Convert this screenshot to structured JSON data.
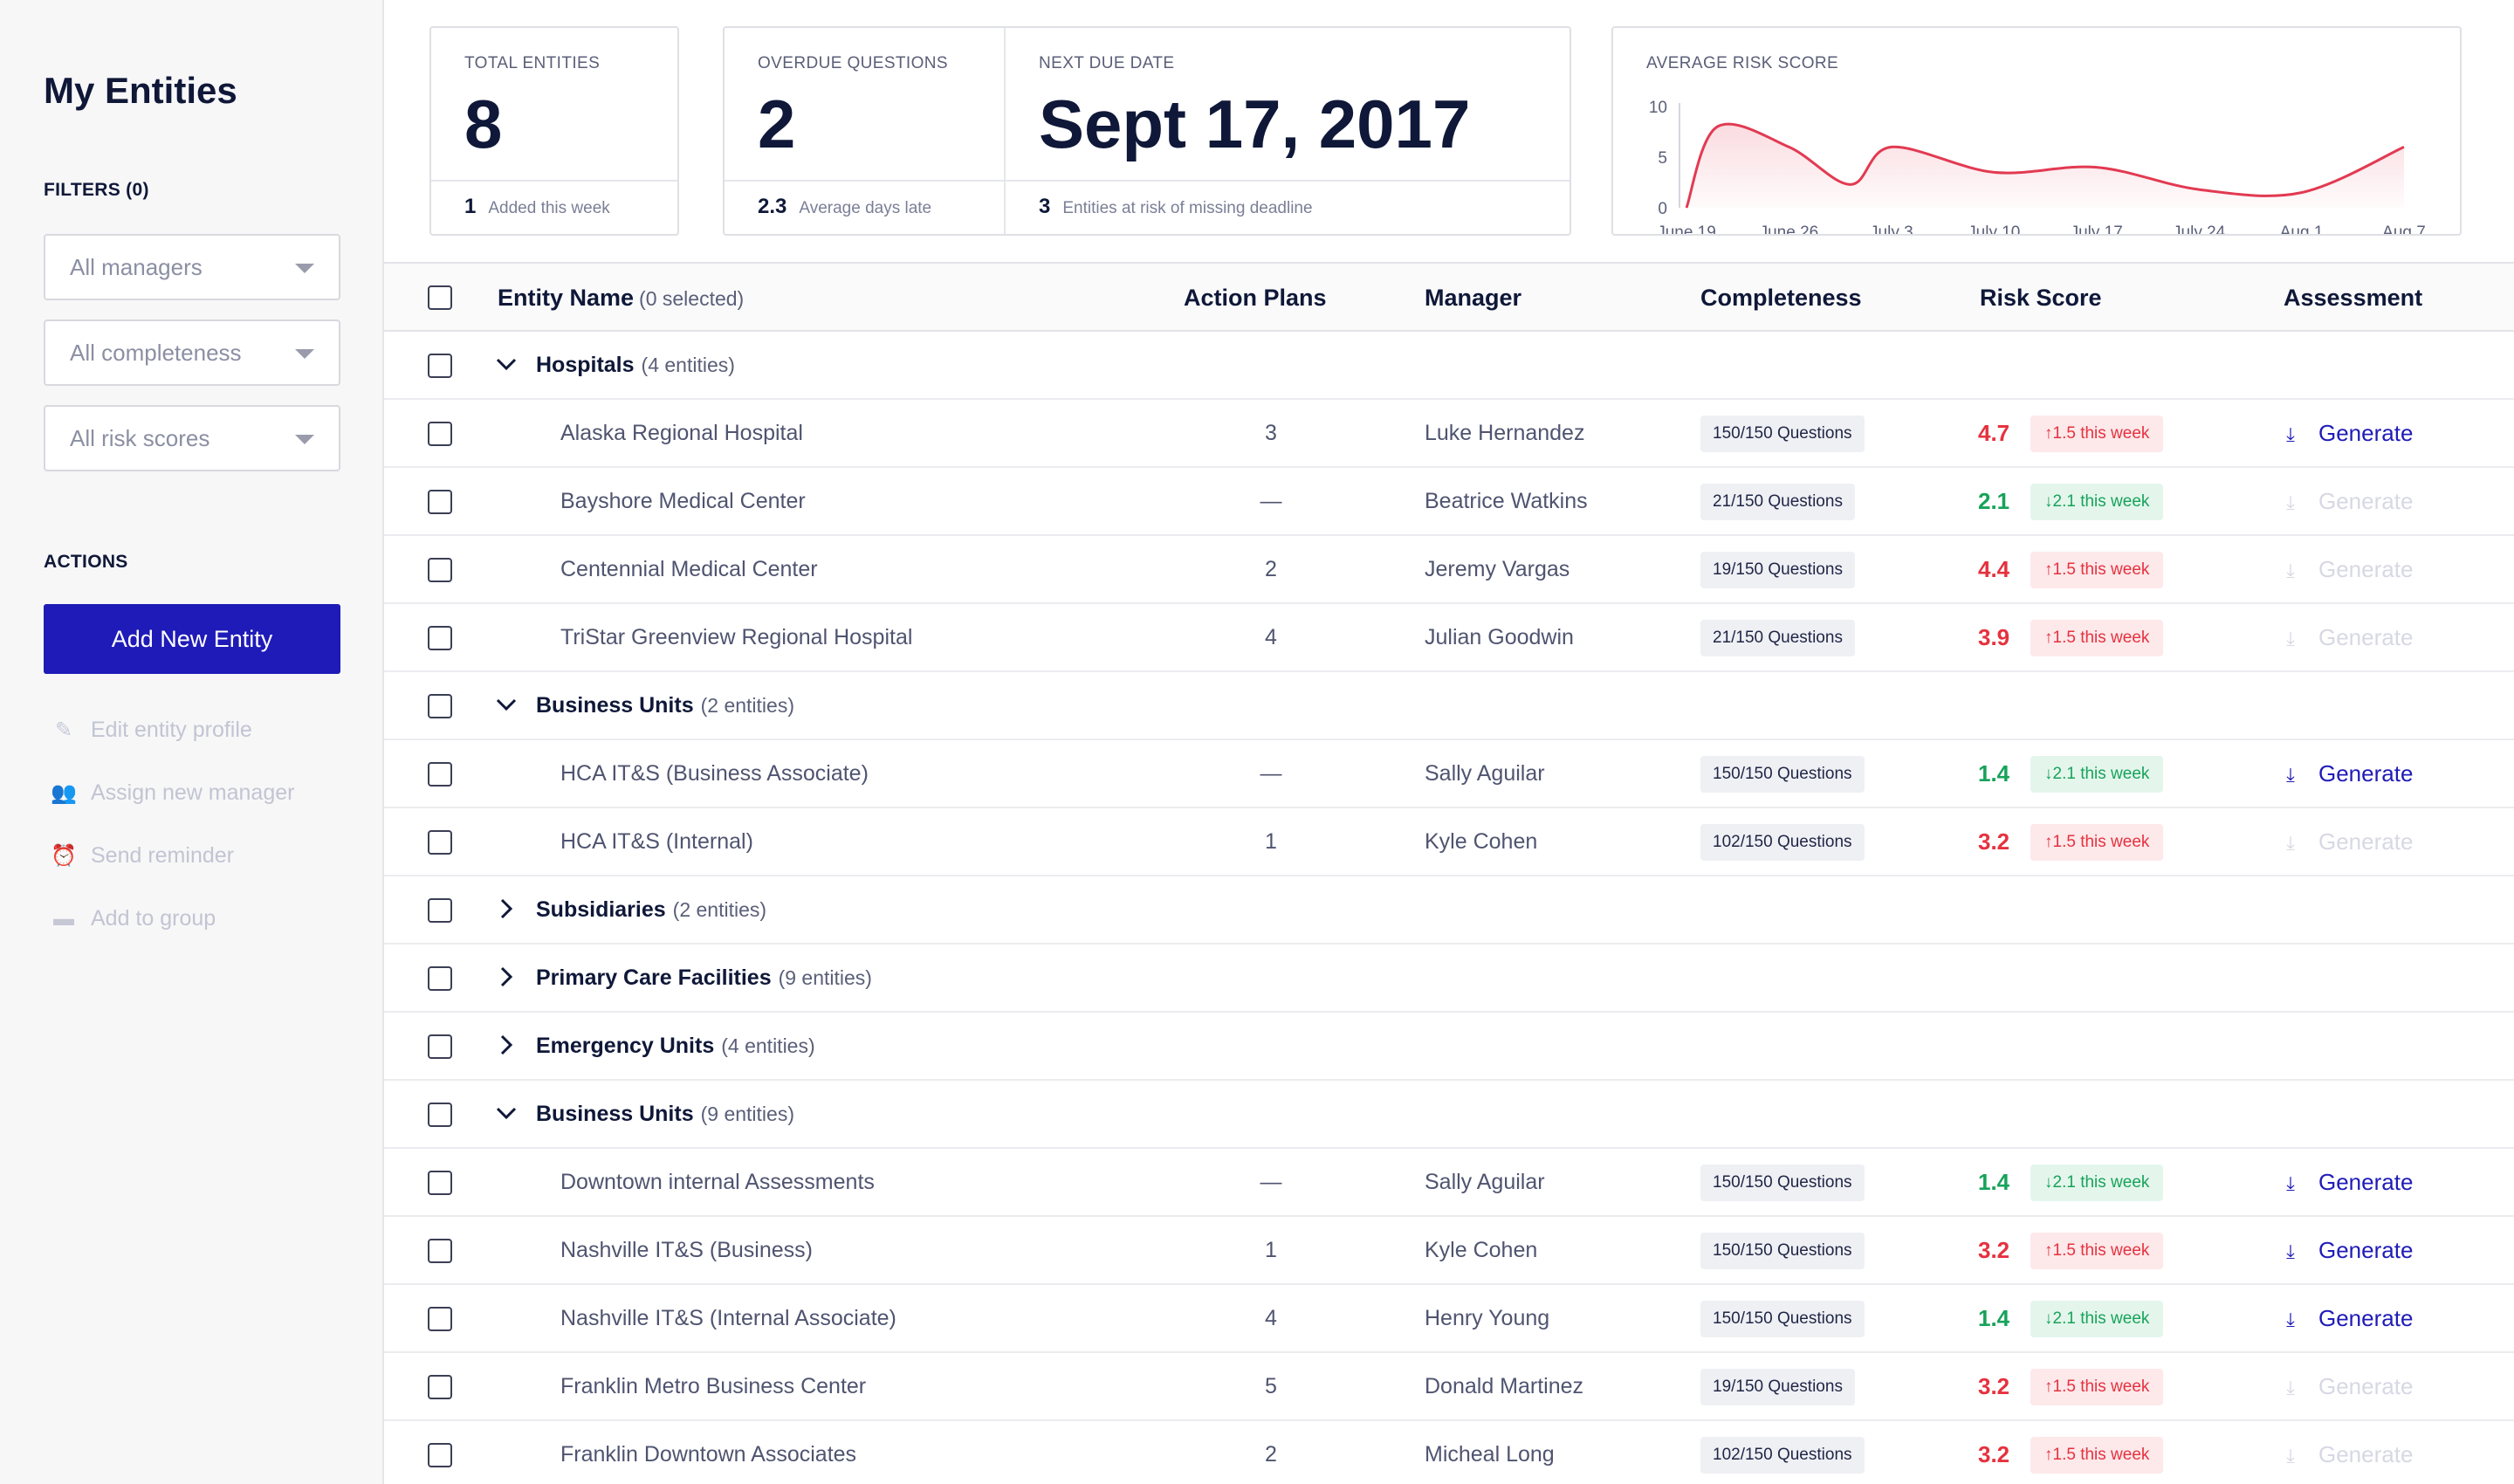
{
  "sidebar": {
    "title": "My Entities",
    "filters_label": "FILTERS (0)",
    "filters": [
      "All managers",
      "All completeness",
      "All risk scores"
    ],
    "actions_label": "ACTIONS",
    "add_button": "Add New Entity",
    "actions": [
      {
        "label": "Edit entity profile",
        "icon": "pencil-icon"
      },
      {
        "label": "Assign new manager",
        "icon": "user-add-icon"
      },
      {
        "label": "Send reminder",
        "icon": "alarm-icon"
      },
      {
        "label": "Add to group",
        "icon": "folder-icon"
      }
    ]
  },
  "kpis": {
    "total": {
      "label": "TOTAL ENTITIES",
      "value": "8",
      "foot_value": "1",
      "foot_label": "Added this week"
    },
    "overdue": {
      "label": "OVERDUE QUESTIONS",
      "value": "2",
      "foot_value": "2.3",
      "foot_label": "Average days late"
    },
    "due": {
      "label": "NEXT DUE DATE",
      "value": "Sept 17, 2017",
      "foot_value": "3",
      "foot_label": "Entities at risk of missing deadline"
    }
  },
  "risk_chart": {
    "label": "AVERAGE RISK SCORE",
    "color": "#e23a52"
  },
  "chart_data": {
    "type": "area",
    "title": "AVERAGE RISK SCORE",
    "categories": [
      "June 19",
      "June 26",
      "July 3",
      "July 10",
      "July 17",
      "July 24",
      "Aug 1",
      "Aug 7"
    ],
    "x": [
      0,
      0.3,
      1,
      1.6,
      2,
      3,
      4,
      5,
      6,
      7
    ],
    "y": [
      0,
      8,
      6,
      2.3,
      6,
      3.5,
      4,
      1.8,
      1.5,
      6
    ],
    "yticks": [
      0,
      5,
      10
    ],
    "ylim": [
      0,
      10
    ],
    "grid": false,
    "color": "#e23a52"
  },
  "table": {
    "headers": {
      "name": "Entity Name",
      "selected": "(0 selected)",
      "plans": "Action Plans",
      "manager": "Manager",
      "completeness": "Completeness",
      "risk": "Risk Score",
      "assessment": "Assessment"
    },
    "generate_label": "Generate",
    "rows": [
      {
        "type": "group",
        "name": "Hospitals",
        "count": "(4 entities)",
        "expanded": true
      },
      {
        "type": "entity",
        "name": "Alaska Regional Hospital",
        "plans": "3",
        "manager": "Luke Hernandez",
        "completeness": "150/150 Questions",
        "risk": "4.7",
        "trend": "up",
        "delta": "1.5 this week",
        "generate_enabled": true
      },
      {
        "type": "entity",
        "name": "Bayshore Medical Center",
        "plans": "—",
        "manager": "Beatrice Watkins",
        "completeness": "21/150 Questions",
        "risk": "2.1",
        "trend": "down",
        "delta": "2.1 this week",
        "generate_enabled": false
      },
      {
        "type": "entity",
        "name": "Centennial Medical Center",
        "plans": "2",
        "manager": "Jeremy Vargas",
        "completeness": "19/150 Questions",
        "risk": "4.4",
        "trend": "up",
        "delta": "1.5 this week",
        "generate_enabled": false
      },
      {
        "type": "entity",
        "name": "TriStar Greenview Regional Hospital",
        "plans": "4",
        "manager": "Julian Goodwin",
        "completeness": "21/150 Questions",
        "risk": "3.9",
        "trend": "up",
        "delta": "1.5 this week",
        "generate_enabled": false
      },
      {
        "type": "group",
        "name": "Business Units",
        "count": "(2 entities)",
        "expanded": true
      },
      {
        "type": "entity",
        "name": "HCA IT&S (Business Associate)",
        "plans": "—",
        "manager": "Sally Aguilar",
        "completeness": "150/150 Questions",
        "risk": "1.4",
        "trend": "down",
        "delta": "2.1 this week",
        "generate_enabled": true
      },
      {
        "type": "entity",
        "name": "HCA IT&S (Internal)",
        "plans": "1",
        "manager": "Kyle Cohen",
        "completeness": "102/150 Questions",
        "risk": "3.2",
        "trend": "up",
        "delta": "1.5 this week",
        "generate_enabled": false
      },
      {
        "type": "group",
        "name": "Subsidiaries",
        "count": "(2 entities)",
        "expanded": false
      },
      {
        "type": "group",
        "name": "Primary Care Facilities",
        "count": "(9 entities)",
        "expanded": false
      },
      {
        "type": "group",
        "name": "Emergency Units",
        "count": "(4 entities)",
        "expanded": false
      },
      {
        "type": "group",
        "name": "Business Units",
        "count": "(9 entities)",
        "expanded": true
      },
      {
        "type": "entity",
        "name": "Downtown internal Assessments",
        "plans": "—",
        "manager": "Sally Aguilar",
        "completeness": "150/150 Questions",
        "risk": "1.4",
        "trend": "down",
        "delta": "2.1 this week",
        "generate_enabled": true
      },
      {
        "type": "entity",
        "name": "Nashville IT&S (Business)",
        "plans": "1",
        "manager": "Kyle Cohen",
        "completeness": "150/150 Questions",
        "risk": "3.2",
        "trend": "up",
        "delta": "1.5 this week",
        "generate_enabled": true
      },
      {
        "type": "entity",
        "name": "Nashville IT&S (Internal Associate)",
        "plans": "4",
        "manager": "Henry Young",
        "completeness": "150/150 Questions",
        "risk": "1.4",
        "trend": "down",
        "delta": "2.1 this week",
        "generate_enabled": true
      },
      {
        "type": "entity",
        "name": "Franklin Metro Business Center",
        "plans": "5",
        "manager": "Donald Martinez",
        "completeness": "19/150 Questions",
        "risk": "3.2",
        "trend": "up",
        "delta": "1.5 this week",
        "generate_enabled": false
      },
      {
        "type": "entity",
        "name": "Franklin Downtown Associates",
        "plans": "2",
        "manager": "Micheal Long",
        "completeness": "102/150 Questions",
        "risk": "3.2",
        "trend": "up",
        "delta": "1.5 this week",
        "generate_enabled": false
      }
    ]
  }
}
